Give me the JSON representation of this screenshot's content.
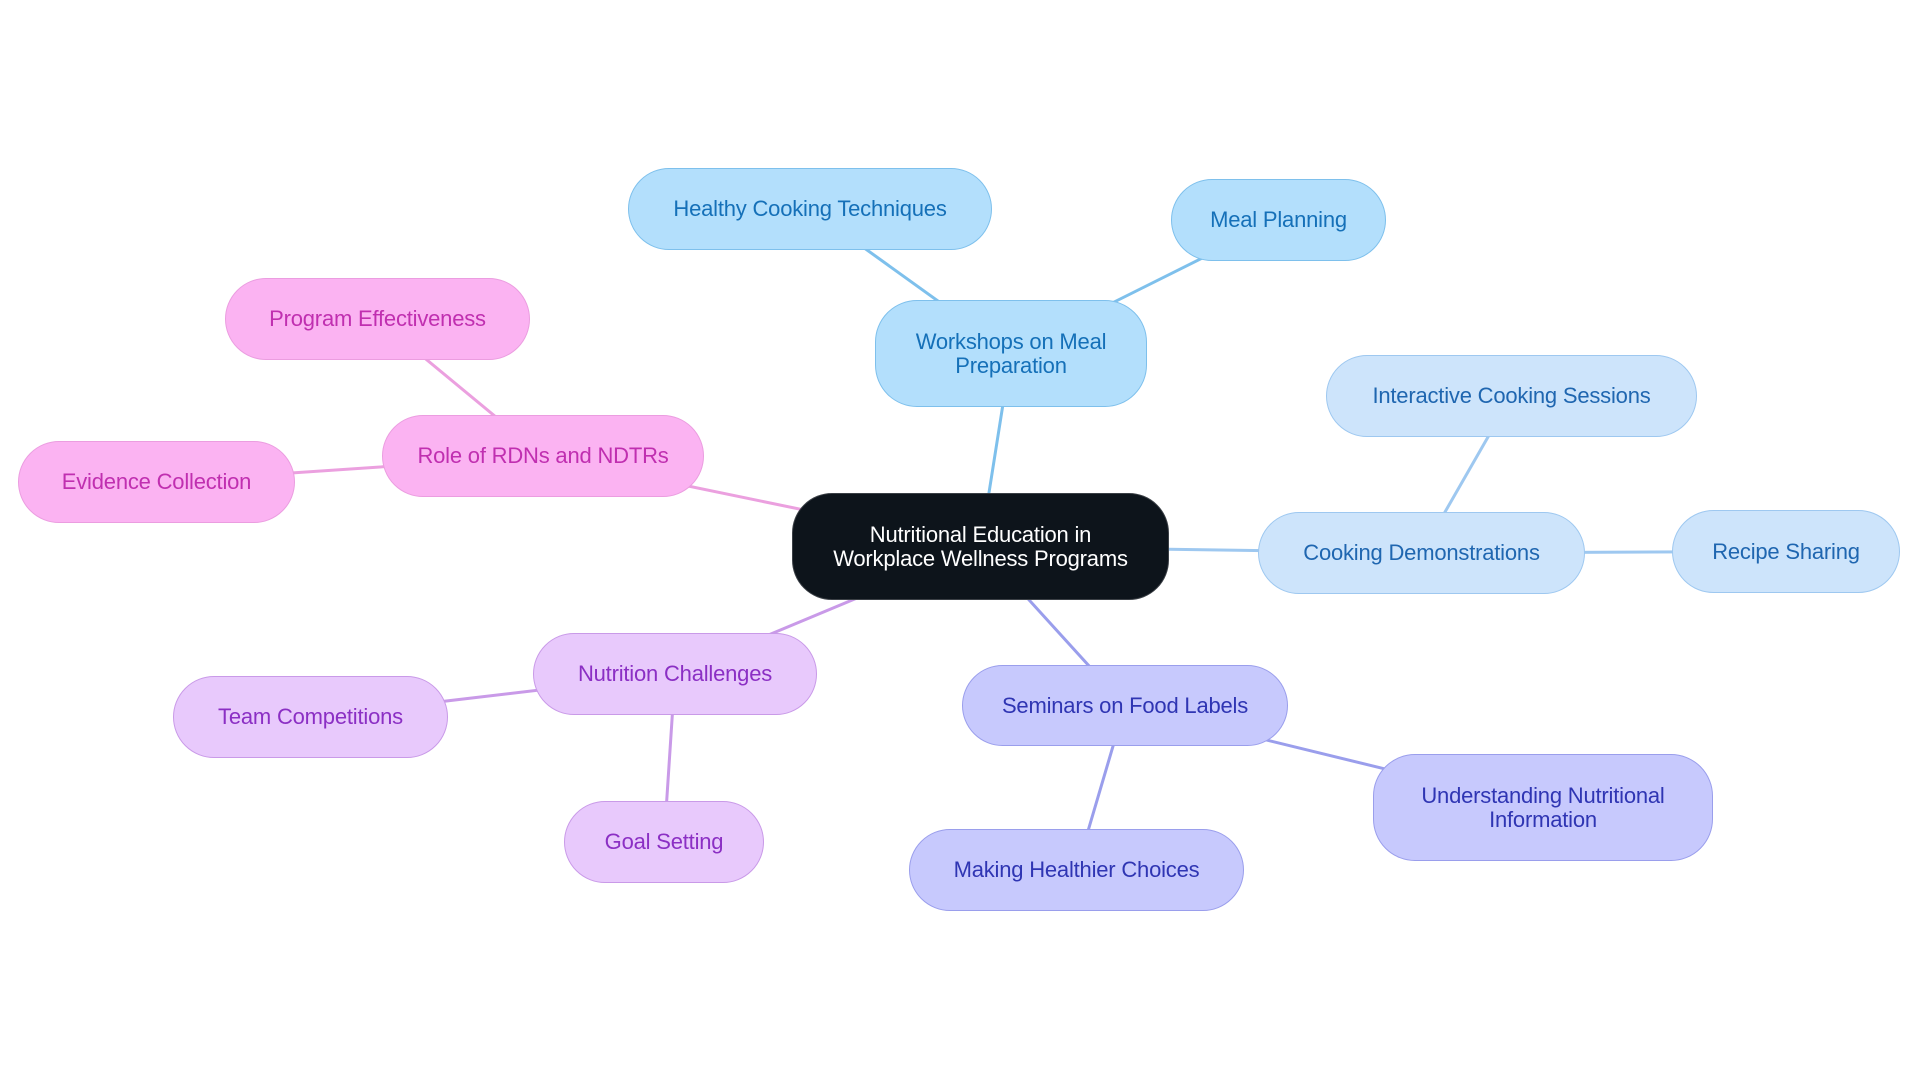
{
  "diagram": {
    "type": "mindmap",
    "root": {
      "id": "n-root",
      "label": "Nutritional Education in Workplace Wellness Programs",
      "colors": {
        "fill": "#0d141b",
        "border": "#3a3f45",
        "text": "#ffffff"
      }
    },
    "branches": [
      {
        "id": "n-workshops",
        "label": "Workshops on Meal Preparation",
        "colors": {
          "fill": "#b3dffc",
          "border": "#7ec0ec",
          "text": "#1570b8",
          "edge": "#7ec0ec"
        },
        "children": [
          {
            "id": "n-healthy",
            "label": "Healthy Cooking Techniques"
          },
          {
            "id": "n-mealplan",
            "label": "Meal Planning"
          }
        ]
      },
      {
        "id": "n-demos",
        "label": "Cooking Demonstrations",
        "colors": {
          "fill": "#cde4fb",
          "border": "#9ec8f0",
          "text": "#1f66b0",
          "edge": "#9ec8f0"
        },
        "children": [
          {
            "id": "n-interactive",
            "label": "Interactive Cooking Sessions"
          },
          {
            "id": "n-recipe",
            "label": "Recipe Sharing"
          }
        ]
      },
      {
        "id": "n-seminars",
        "label": "Seminars on Food Labels",
        "colors": {
          "fill": "#c7c9fd",
          "border": "#9a9eec",
          "text": "#2f35b3",
          "edge": "#9a9eec"
        },
        "children": [
          {
            "id": "n-understand",
            "label": "Understanding Nutritional Information"
          },
          {
            "id": "n-healthier",
            "label": "Making Healthier Choices"
          }
        ]
      },
      {
        "id": "n-challenges",
        "label": "Nutrition Challenges",
        "colors": {
          "fill": "#e8c9fc",
          "border": "#c99ae8",
          "text": "#8b2fc4",
          "edge": "#c99ae8"
        },
        "children": [
          {
            "id": "n-team",
            "label": "Team Competitions"
          },
          {
            "id": "n-goal",
            "label": "Goal Setting"
          }
        ]
      },
      {
        "id": "n-rdns",
        "label": "Role of RDNs and NDTRs",
        "colors": {
          "fill": "#fbb3f2",
          "border": "#eb9de0",
          "text": "#c02fb0",
          "edge": "#eba0df"
        },
        "children": [
          {
            "id": "n-program",
            "label": "Program Effectiveness"
          },
          {
            "id": "n-evidence",
            "label": "Evidence Collection"
          }
        ]
      }
    ]
  }
}
